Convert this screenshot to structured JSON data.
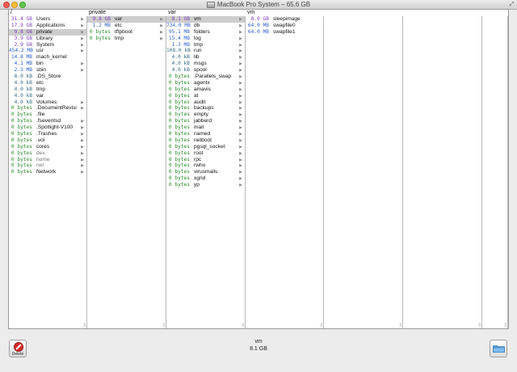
{
  "window": {
    "title": "MacBook Pro System – 65.6 GB"
  },
  "columns": [
    {
      "header": "/",
      "rows": [
        {
          "size": "31.4 GB",
          "name": "Users",
          "arrow": true,
          "unit": "gb"
        },
        {
          "size": "17.9 GB",
          "name": "Applications",
          "arrow": true,
          "unit": "gb"
        },
        {
          "size": "9.8 GB",
          "name": "private",
          "arrow": true,
          "unit": "gb",
          "selected": true
        },
        {
          "size": "3.9 GB",
          "name": "Library",
          "arrow": true,
          "unit": "gb"
        },
        {
          "size": "2.9 GB",
          "name": "System",
          "arrow": true,
          "unit": "gb"
        },
        {
          "size": "454.2 MB",
          "name": "usr",
          "arrow": true,
          "unit": "mb"
        },
        {
          "size": "14.8 MB",
          "name": "mach_kernel",
          "arrow": false,
          "unit": "mb"
        },
        {
          "size": "4.1 MB",
          "name": "bin",
          "arrow": true,
          "unit": "mb"
        },
        {
          "size": "2.3 MB",
          "name": "sbin",
          "arrow": true,
          "unit": "mb"
        },
        {
          "size": "8.0 kB",
          "name": ".DS_Store",
          "arrow": false,
          "unit": "kb"
        },
        {
          "size": "4.0 kB",
          "name": "etc",
          "arrow": false,
          "unit": "kb"
        },
        {
          "size": "4.0 kB",
          "name": "tmp",
          "arrow": false,
          "unit": "kb"
        },
        {
          "size": "4.0 kB",
          "name": "var",
          "arrow": false,
          "unit": "kb"
        },
        {
          "size": "4.0 kB",
          "name": "Volumes",
          "arrow": true,
          "unit": "kb"
        },
        {
          "size": "0 bytes",
          "name": ".DocumentRevisi",
          "arrow": true,
          "unit": "zero"
        },
        {
          "size": "0 bytes",
          "name": ".file",
          "arrow": false,
          "unit": "zero"
        },
        {
          "size": "0 bytes",
          "name": ".fseventsd",
          "arrow": true,
          "unit": "zero"
        },
        {
          "size": "0 bytes",
          "name": ".Spotlight-V100",
          "arrow": true,
          "unit": "zero"
        },
        {
          "size": "0 bytes",
          "name": ".Trashes",
          "arrow": true,
          "unit": "zero"
        },
        {
          "size": "0 bytes",
          "name": ".vol",
          "arrow": true,
          "unit": "zero"
        },
        {
          "size": "0 bytes",
          "name": "cores",
          "arrow": true,
          "unit": "zero"
        },
        {
          "size": "0 bytes",
          "name": "dev",
          "arrow": true,
          "unit": "zero",
          "dim": true
        },
        {
          "size": "0 bytes",
          "name": "home",
          "arrow": true,
          "unit": "zero",
          "dim": true
        },
        {
          "size": "0 bytes",
          "name": "net",
          "arrow": true,
          "unit": "zero",
          "dim": true
        },
        {
          "size": "0 bytes",
          "name": "Network",
          "arrow": true,
          "unit": "zero"
        }
      ]
    },
    {
      "header": "private",
      "rows": [
        {
          "size": "9.8 GB",
          "name": "var",
          "arrow": true,
          "unit": "gb",
          "selected": true
        },
        {
          "size": "1.2 MB",
          "name": "etc",
          "arrow": true,
          "unit": "mb"
        },
        {
          "size": "0 bytes",
          "name": "tftpboot",
          "arrow": true,
          "unit": "zero"
        },
        {
          "size": "0 bytes",
          "name": "tmp",
          "arrow": true,
          "unit": "zero"
        }
      ]
    },
    {
      "header": "var",
      "rows": [
        {
          "size": "8.1 GB",
          "name": "vm",
          "arrow": true,
          "unit": "gb",
          "selected": true
        },
        {
          "size": "734.0 MB",
          "name": "db",
          "arrow": true,
          "unit": "mb"
        },
        {
          "size": "95.1 MB",
          "name": "folders",
          "arrow": true,
          "unit": "mb"
        },
        {
          "size": "15.4 MB",
          "name": "log",
          "arrow": true,
          "unit": "mb"
        },
        {
          "size": "1.3 MB",
          "name": "tmp",
          "arrow": true,
          "unit": "mb"
        },
        {
          "size": "108.0 kB",
          "name": "run",
          "arrow": true,
          "unit": "kb"
        },
        {
          "size": "4.0 kB",
          "name": "lib",
          "arrow": true,
          "unit": "kb"
        },
        {
          "size": "4.0 kB",
          "name": "msgs",
          "arrow": true,
          "unit": "kb"
        },
        {
          "size": "4.0 kB",
          "name": "spool",
          "arrow": true,
          "unit": "kb"
        },
        {
          "size": "0 bytes",
          "name": ".Parallels_swap",
          "arrow": true,
          "unit": "zero"
        },
        {
          "size": "0 bytes",
          "name": "agentx",
          "arrow": true,
          "unit": "zero"
        },
        {
          "size": "0 bytes",
          "name": "amavis",
          "arrow": true,
          "unit": "zero"
        },
        {
          "size": "0 bytes",
          "name": "at",
          "arrow": true,
          "unit": "zero"
        },
        {
          "size": "0 bytes",
          "name": "audit",
          "arrow": true,
          "unit": "zero"
        },
        {
          "size": "0 bytes",
          "name": "backups",
          "arrow": true,
          "unit": "zero"
        },
        {
          "size": "0 bytes",
          "name": "empty",
          "arrow": true,
          "unit": "zero"
        },
        {
          "size": "0 bytes",
          "name": "jabberd",
          "arrow": true,
          "unit": "zero"
        },
        {
          "size": "0 bytes",
          "name": "mail",
          "arrow": true,
          "unit": "zero"
        },
        {
          "size": "0 bytes",
          "name": "named",
          "arrow": true,
          "unit": "zero"
        },
        {
          "size": "0 bytes",
          "name": "netboot",
          "arrow": true,
          "unit": "zero"
        },
        {
          "size": "0 bytes",
          "name": "pgsql_socket",
          "arrow": true,
          "unit": "zero"
        },
        {
          "size": "0 bytes",
          "name": "root",
          "arrow": true,
          "unit": "zero"
        },
        {
          "size": "0 bytes",
          "name": "rpc",
          "arrow": true,
          "unit": "zero"
        },
        {
          "size": "0 bytes",
          "name": "rwho",
          "arrow": true,
          "unit": "zero"
        },
        {
          "size": "0 bytes",
          "name": "virusmails",
          "arrow": true,
          "unit": "zero"
        },
        {
          "size": "0 bytes",
          "name": "xgrid",
          "arrow": true,
          "unit": "zero"
        },
        {
          "size": "0 bytes",
          "name": "yp",
          "arrow": true,
          "unit": "zero"
        }
      ]
    },
    {
      "header": "vm",
      "rows": [
        {
          "size": "8.0 GB",
          "name": "sleepimage",
          "arrow": false,
          "unit": "gb"
        },
        {
          "size": "64.0 MB",
          "name": "swapfile0",
          "arrow": false,
          "unit": "mb"
        },
        {
          "size": "64.0 MB",
          "name": "swapfile1",
          "arrow": false,
          "unit": "mb"
        }
      ]
    },
    {
      "header": "",
      "rows": []
    },
    {
      "header": "",
      "rows": []
    },
    {
      "header": "",
      "rows": []
    }
  ],
  "selection": {
    "name": "vm",
    "size": "8.1 GB"
  },
  "toolbar": {
    "delete_label": "Delete"
  },
  "icons": {
    "delete": "delete-icon",
    "folder": "folder-icon",
    "arrow": "disclosure-arrow-icon"
  },
  "colors": {
    "gb": "#7b3fb8",
    "mb": "#2c5fc8",
    "kb": "#3a6e86",
    "zero": "#2e8b2e",
    "selection": "#cdcdcd"
  }
}
